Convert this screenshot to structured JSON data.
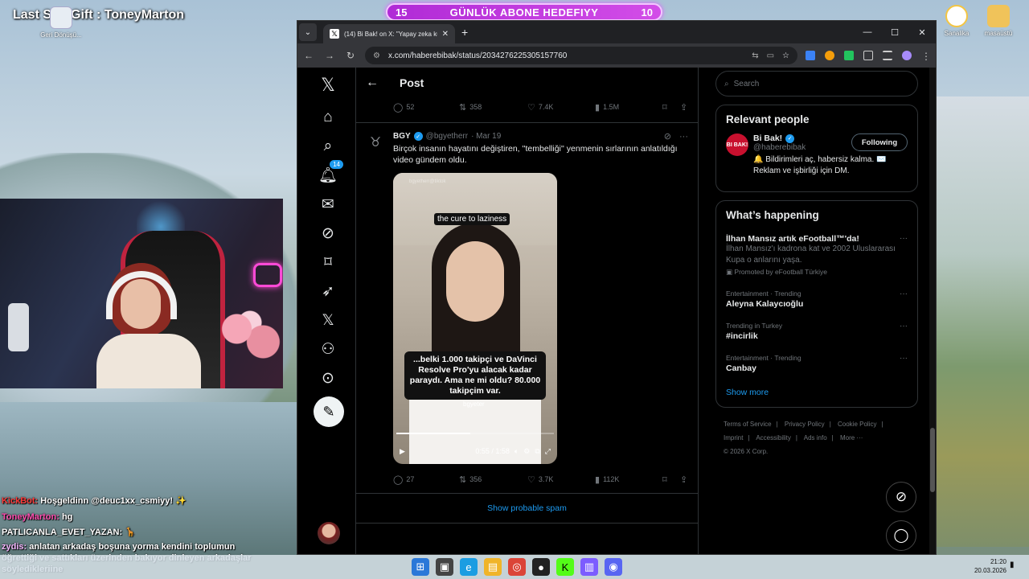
{
  "overlay": {
    "last_sub": "Last Sub Gift : ToneyMarton",
    "goal_left": "15",
    "goal_title": "GÜNLÜK ABONE HEDEFIYY",
    "goal_right": "10",
    "recycle_label": "Geri Dönüşü...",
    "desktop_icons": [
      "Sanalika",
      "masaüstü"
    ]
  },
  "chat": [
    {
      "name": "KickBot:",
      "text": " Hoşgeldinn @deuc1xx_csmiyy! ✨",
      "color": "#ff3b3b"
    },
    {
      "name": "ToneyMarton:",
      "text": " hg",
      "color": "#ff4fb0"
    },
    {
      "name": "PATLICANLA_EVET_YAZAN:",
      "text": " 🦒",
      "color": "#ffffff"
    },
    {
      "name": "zydis:",
      "text": " anlatan arkadaş boşuna yorma kendini toplumun öğrettiği ve sattıkları üzerinden bakıyor dinleyen arkadaşlar söyledikleriine",
      "color": "#f5b8ff"
    }
  ],
  "browser": {
    "tab_title": "(14) Bi Bak! on X: \"Yapay zeka kullı",
    "url": "x.com/haberebibak/status/2034276225305157760",
    "tab_close": "✕",
    "new_tab": "+",
    "win_min": "—",
    "win_max": "☐",
    "win_close": "✕"
  },
  "x": {
    "header_title": "Post",
    "top_actions": {
      "replies": "52",
      "reposts": "358",
      "likes": "7.4K",
      "views": "1.5M"
    },
    "notification_count": "14",
    "tweet": {
      "display_name": "BGY",
      "handle": "@bgyetherr",
      "date": "· Mar 19",
      "text": "Birçok insanın hayatını değiştiren, ''tembelliği'' yenmenin sırlarının anlatıldığı video gündem oldu.",
      "video_caption_top": "the cure to laziness",
      "video_caption_main": "...belki 1.000 takipçi ve DaVinci Resolve Pro'yu alacak kadar paraydı. Ama ne mi oldu? 80.000 takipçim var.",
      "video_caption_name": "bgyeter",
      "video_watermark": "bgyetherr@tiktok",
      "video_time": "0:55 / 1:58",
      "video_progress": 0.47,
      "replies": "27",
      "reposts": "356",
      "likes": "3.7K",
      "views": "112K"
    },
    "show_spam": "Show probable spam",
    "search_placeholder": "Search",
    "relevant": {
      "title": "Relevant people",
      "name": "Bi Bak!",
      "handle": "@haberebibak",
      "bio": "🔔 Bildirimleri aç, habersiz kalma. ✉️ Reklam ve işbirliği için DM.",
      "follow_label": "Following",
      "avatar_text": "BI BAK!"
    },
    "happening": {
      "title": "What’s happening",
      "trends": [
        {
          "context": "",
          "title": "İlhan Mansız artık eFootball™'da!",
          "desc": "İlhan Mansız'ı kadrona kat ve 2002 Uluslararası Kupa o anlarını yaşa.",
          "promo": "Promoted by eFootball Türkiye"
        },
        {
          "context": "Entertainment · Trending",
          "title": "Aleyna Kalaycıoğlu",
          "desc": "",
          "promo": ""
        },
        {
          "context": "Trending in Turkey",
          "title": "#incirlik",
          "desc": "",
          "promo": ""
        },
        {
          "context": "Entertainment · Trending",
          "title": "Canbay",
          "desc": "",
          "promo": ""
        }
      ],
      "show_more": "Show more"
    },
    "footer": [
      "Terms of Service",
      "|",
      "Privacy Policy",
      "|",
      "Cookie Policy",
      "|",
      "Imprint",
      "|",
      "Accessibility",
      "|",
      "Ads info",
      "|",
      "More ···",
      "© 2026 X Corp."
    ]
  },
  "taskbar": {
    "time": "21:20",
    "date": "20.03.2026"
  }
}
